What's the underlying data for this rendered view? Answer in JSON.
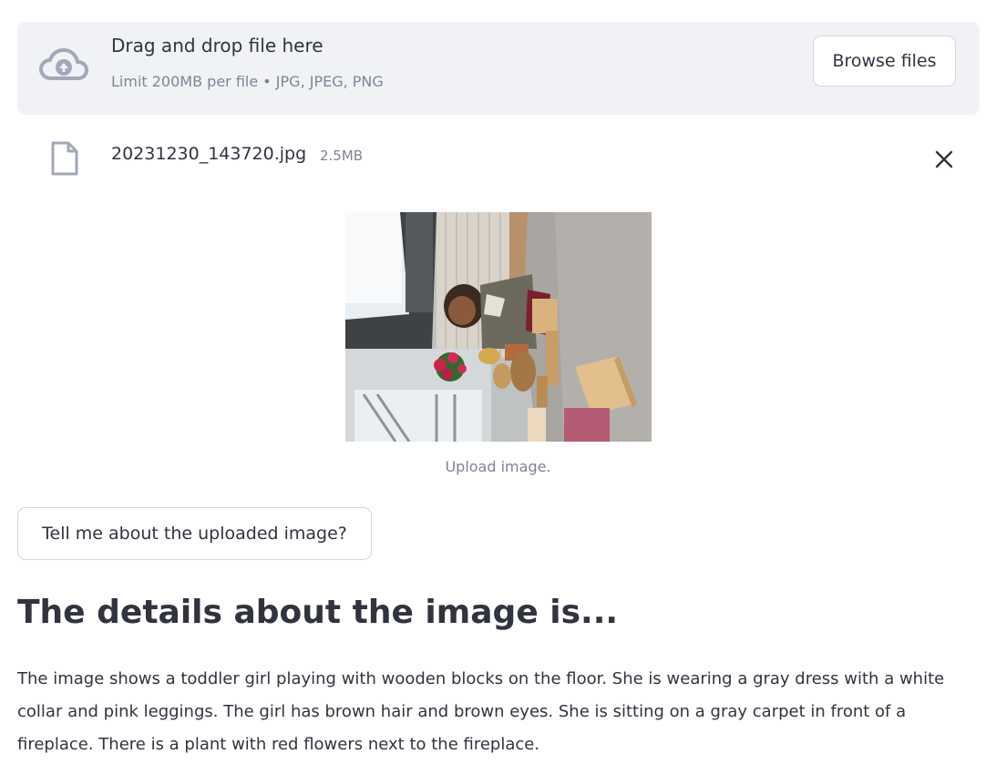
{
  "uploader": {
    "title": "Drag and drop file here",
    "limit": "Limit 200MB per file • JPG, JPEG, PNG",
    "browse_label": "Browse files",
    "icon": "cloud-upload-icon"
  },
  "file": {
    "name": "20231230_143720.jpg",
    "size": "2.5MB",
    "icon": "file-icon"
  },
  "image": {
    "caption": "Upload image."
  },
  "ask_button": {
    "label": "Tell me about the uploaded image?"
  },
  "result": {
    "heading": "The details about the image is...",
    "body": "The image shows a toddler girl playing with wooden blocks on the floor. She is wearing a gray dress with a white collar and pink leggings. The girl has brown hair and brown eyes. She is sitting on a gray carpet in front of a fireplace. There is a plant with red flowers next to the fireplace."
  },
  "colors": {
    "text": "#31333f",
    "muted": "#808495",
    "dropzone_bg": "#f0f2f6",
    "border": "#d6d6d9",
    "icon": "#a3a8b8"
  }
}
